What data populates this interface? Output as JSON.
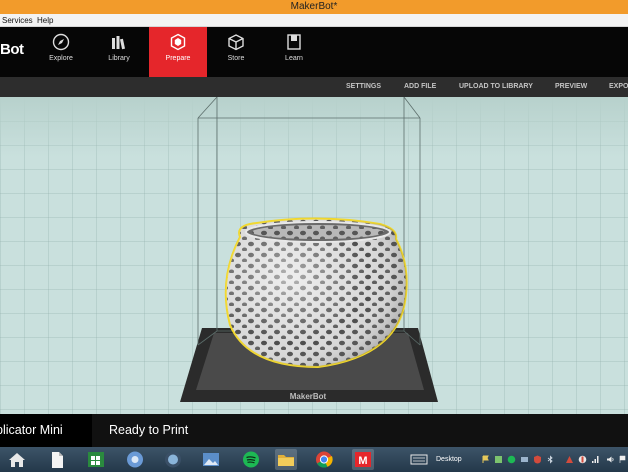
{
  "window": {
    "title": "MakerBot*"
  },
  "menu": {
    "items": [
      "Services",
      "Help"
    ]
  },
  "logo": {
    "text": "Bot"
  },
  "nav": {
    "items": [
      {
        "label": "Explore",
        "icon": "compass-icon"
      },
      {
        "label": "Library",
        "icon": "library-icon"
      },
      {
        "label": "Prepare",
        "icon": "prepare-cube-icon",
        "active": true
      },
      {
        "label": "Store",
        "icon": "store-box-icon"
      },
      {
        "label": "Learn",
        "icon": "learn-book-icon"
      }
    ]
  },
  "toolbar": {
    "items": [
      "SETTINGS",
      "ADD FILE",
      "UPLOAD TO LIBRARY",
      "PREVIEW",
      "EXPO"
    ]
  },
  "viewport": {
    "plate_label": "MakerBot",
    "model": "perforated-bowl",
    "selection_color": "#f1d72c"
  },
  "status": {
    "printer": "plicator Mini",
    "message": "Ready to Print"
  },
  "taskbar": {
    "desktop_label": "Desktop"
  },
  "colors": {
    "accent": "#e5262b",
    "titlebar": "#f29b2b",
    "navbar": "#060606",
    "toolbar": "#2d2d2d"
  }
}
